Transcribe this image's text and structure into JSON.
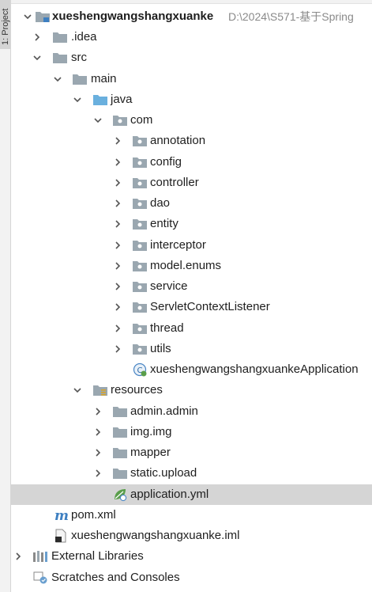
{
  "side_panel": {
    "tab_label": "1: Project"
  },
  "tree": {
    "project": {
      "name": "xueshengwangshangxuanke",
      "path": "D:\\2024\\S571-基于Spring"
    },
    "idea": ".idea",
    "src": "src",
    "main": "main",
    "java": "java",
    "com": "com",
    "packages": [
      "annotation",
      "config",
      "controller",
      "dao",
      "entity",
      "interceptor",
      "model.enums",
      "service",
      "ServletContextListener",
      "thread",
      "utils"
    ],
    "application_class": "xueshengwangshangxuankeApplication",
    "resources": "resources",
    "resource_folders": [
      "admin.admin",
      "img.img",
      "mapper",
      "static.upload"
    ],
    "application_yml": "application.yml",
    "pom": "pom.xml",
    "iml": "xueshengwangshangxuanke.iml",
    "external_libraries": "External Libraries",
    "scratches": "Scratches and Consoles"
  },
  "colors": {
    "folder": "#9aa7b0",
    "source_folder": "#6ab0de",
    "selection": "#d5d5d5",
    "path_gray": "#8a8a8a",
    "maven_blue": "#3d7fc1",
    "spring_green": "#5a9e4b"
  }
}
